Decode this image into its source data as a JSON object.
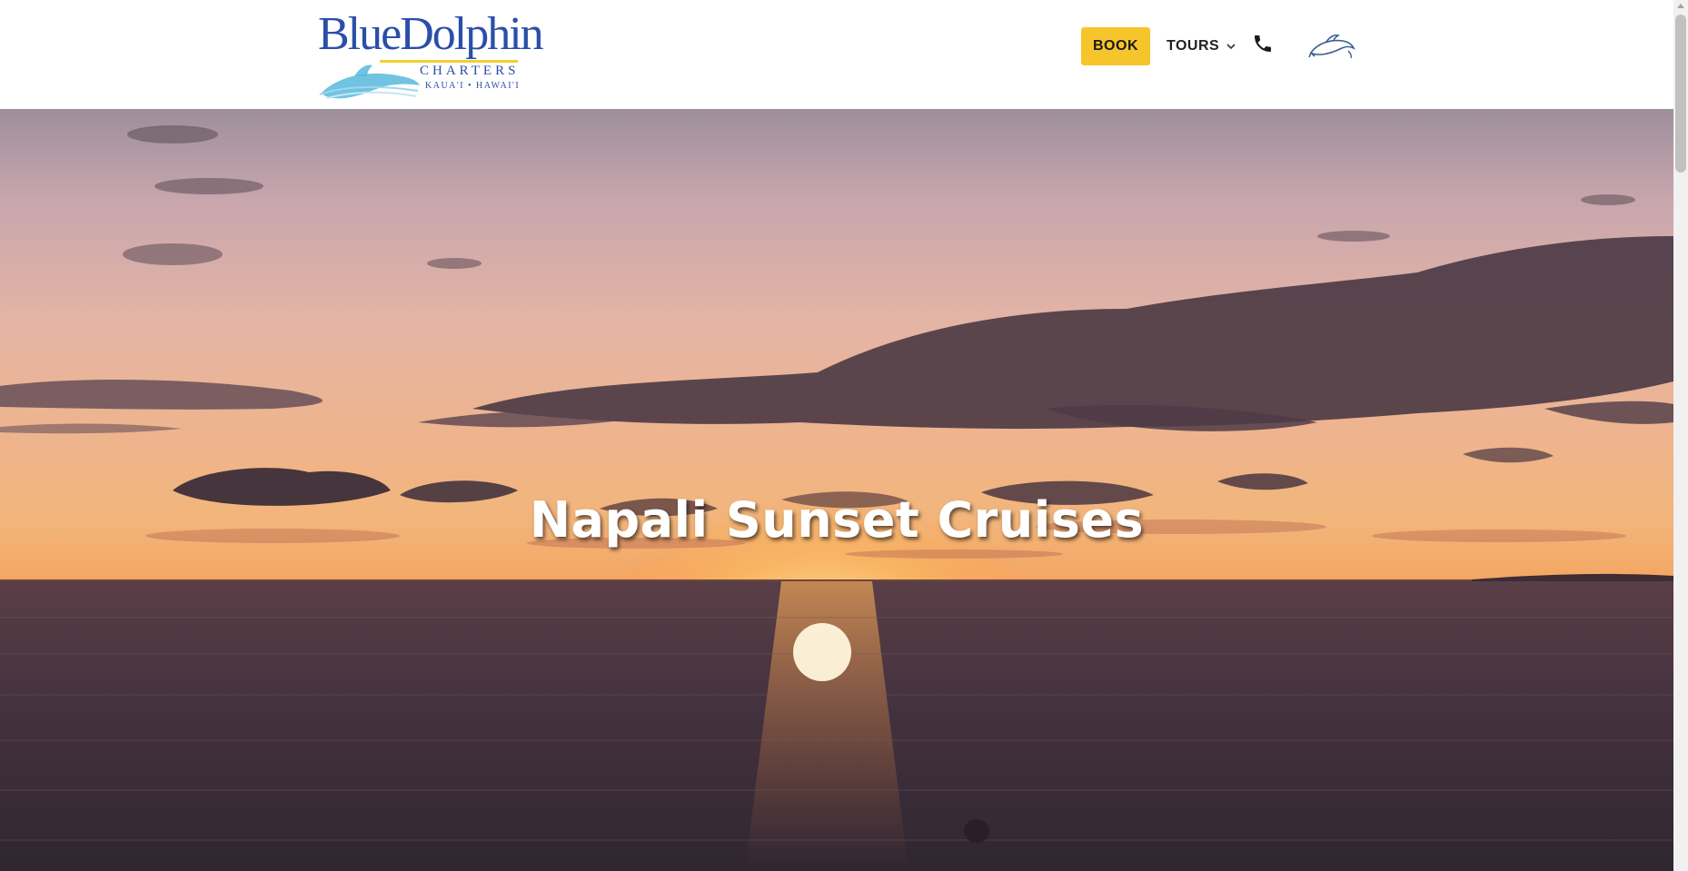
{
  "brand": {
    "logo_word": "BlueDolphin",
    "logo_charters": "CHARTERS",
    "logo_location": "KAUA'I • HAWAI'I"
  },
  "nav": {
    "book_label": "BOOK",
    "tours_label": "TOURS",
    "tours_icon": "chevron-down-icon",
    "phone_icon": "phone-icon",
    "dolphin_icon": "dolphin-icon"
  },
  "hero": {
    "title": "Napali Sunset Cruises",
    "scene": "sunset-over-ocean"
  },
  "colors": {
    "accent": "#f6c52b",
    "brand_blue": "#2a4fa8",
    "logo_stripe": "#f2cf2d",
    "nav_text": "#222222",
    "title_text": "#ffffff"
  }
}
